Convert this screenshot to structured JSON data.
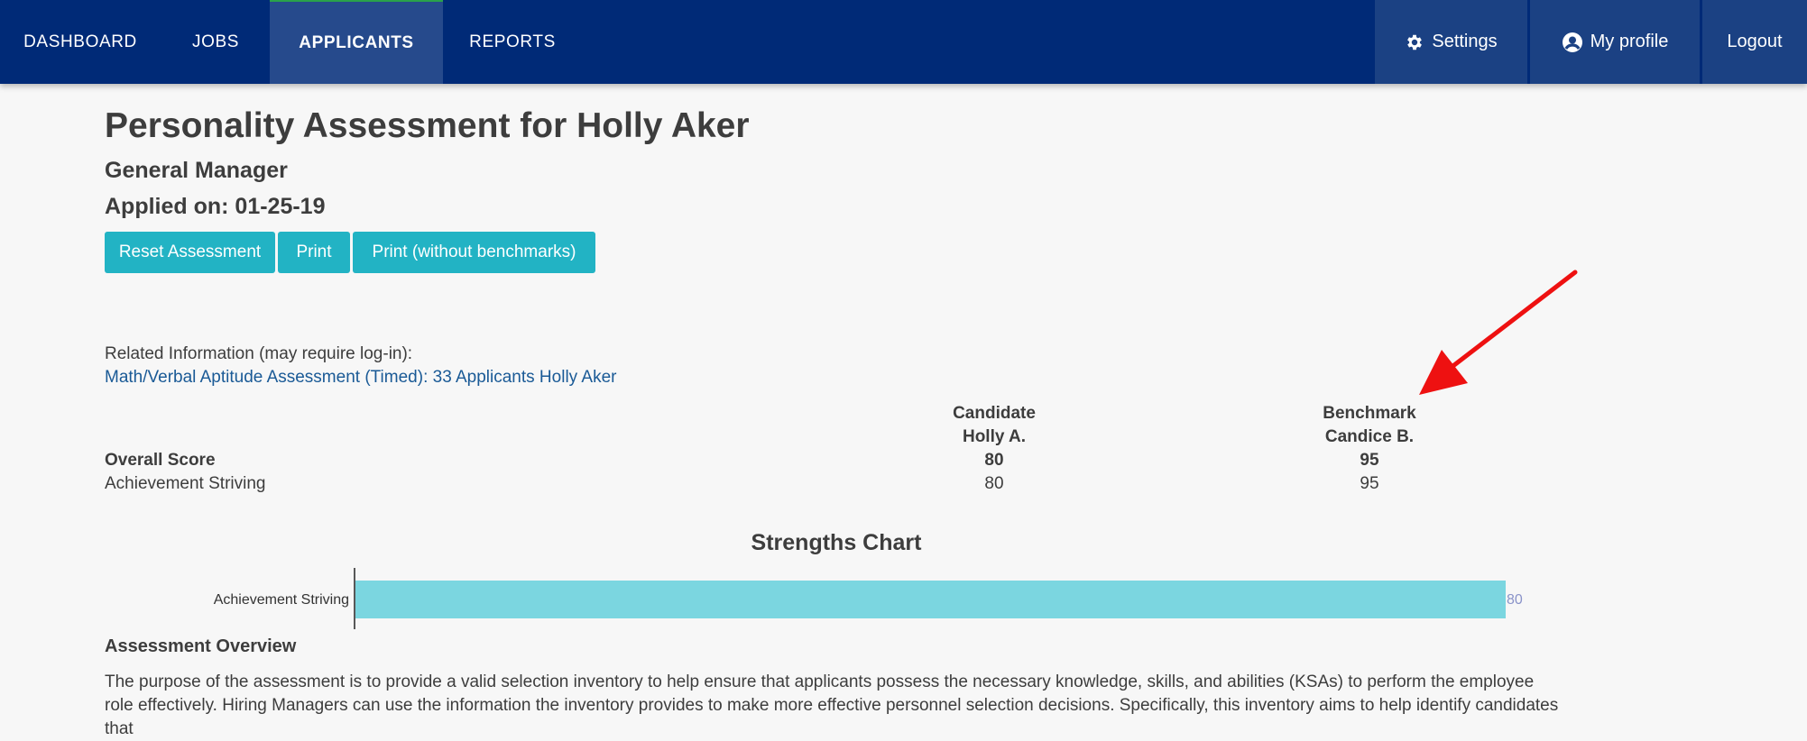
{
  "nav": {
    "items": [
      {
        "label": "DASHBOARD"
      },
      {
        "label": "JOBS"
      },
      {
        "label": "APPLICANTS"
      },
      {
        "label": "REPORTS"
      }
    ],
    "active": "APPLICANTS",
    "settings_label": "Settings",
    "profile_label": "My profile",
    "logout_label": "Logout"
  },
  "page": {
    "title": "Personality Assessment for Holly Aker",
    "subtitle": "General Manager",
    "applied": "Applied on: 01-25-19"
  },
  "actions": {
    "reset_label": "Reset Assessment",
    "print_label": "Print",
    "print_no_bench_label": "Print (without benchmarks)"
  },
  "related": {
    "label": "Related Information (may require log-in):",
    "link": "Math/Verbal Aptitude Assessment (Timed): 33 Applicants Holly Aker"
  },
  "scores": {
    "candidate_header": "Candidate",
    "candidate_name": "Holly A.",
    "benchmark_header": "Benchmark",
    "benchmark_name": "Candice B.",
    "rows": [
      {
        "label": "Overall Score",
        "candidate": "80",
        "benchmark": "95"
      },
      {
        "label": "Achievement Striving",
        "candidate": "80",
        "benchmark": "95"
      }
    ]
  },
  "chart_data": {
    "type": "bar",
    "title": "Strengths Chart",
    "categories": [
      "Achievement Striving"
    ],
    "values": [
      80
    ],
    "value_labels": [
      "80"
    ],
    "xlim": [
      0,
      80
    ],
    "orientation": "horizontal",
    "bar_color": "#7bd6e0",
    "label_color": "#8a93c9"
  },
  "overview": {
    "heading": "Assessment Overview",
    "text": "The purpose of the assessment is to provide a valid selection inventory to help ensure that applicants possess the necessary knowledge, skills, and abilities (KSAs) to perform the employee role effectively. Hiring Managers can use the information the inventory provides to make more effective personnel selection decisions. Specifically, this inventory aims to help identify candidates that"
  },
  "colors": {
    "nav_bg": "#002a77",
    "button_bg": "#22b3c4",
    "link": "#1a5a96",
    "annotation_arrow": "#ee1111"
  }
}
